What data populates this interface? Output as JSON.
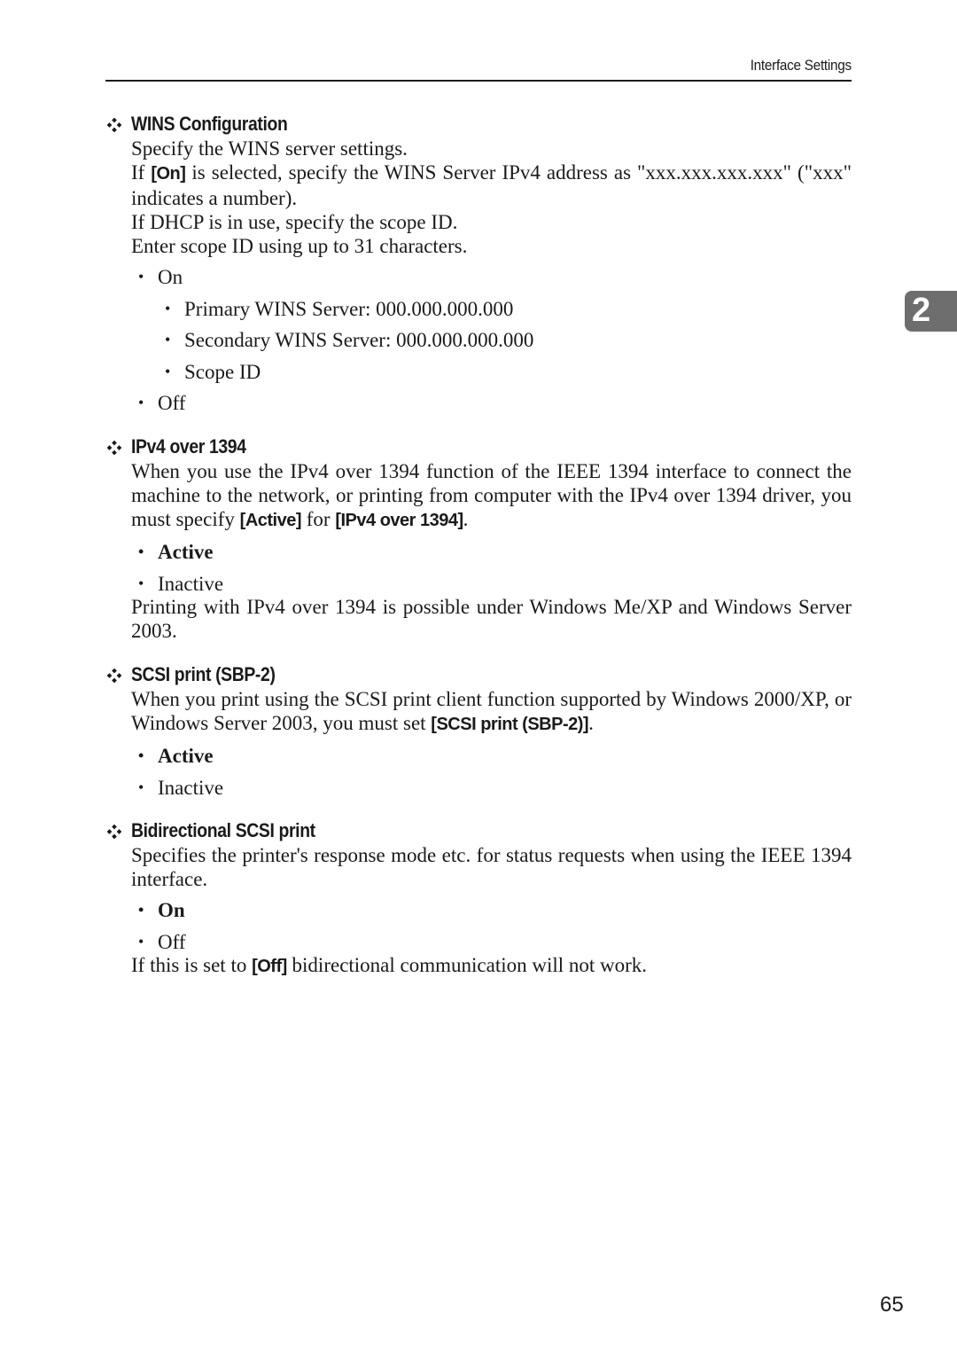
{
  "header": {
    "running_title": "Interface Settings"
  },
  "chapter_tab": {
    "number": "2"
  },
  "sections": {
    "wins": {
      "heading": "WINS Configuration",
      "p1": "Specify the WINS server settings.",
      "p2_pre": "If ",
      "p2_kw": "[On]",
      "p2_post": " is selected, specify the WINS Server IPv4 address as \"xxx.xxx.xxx.xxx\" (\"xxx\" indicates a number).",
      "p3": "If DHCP is in use, specify the scope ID.",
      "p4": "Enter scope ID using up to 31 characters.",
      "options": {
        "on": "On",
        "primary": "Primary WINS Server: 000.000.000.000",
        "secondary": "Secondary WINS Server: 000.000.000.000",
        "scope": "Scope ID",
        "off": "Off"
      }
    },
    "ipv4": {
      "heading": "IPv4 over 1394",
      "p1_pre": "When you use the IPv4 over 1394 function of the IEEE 1394 interface to connect the machine to the network, or printing from computer with the IPv4 over 1394 driver, you must specify ",
      "p1_kw1": "[Active]",
      "p1_mid": " for ",
      "p1_kw2": "[IPv4 over 1394]",
      "p1_post": ".",
      "options": {
        "active": "Active",
        "inactive": "Inactive"
      },
      "note": "Printing with IPv4 over 1394 is possible under Windows Me/XP and Windows Server 2003."
    },
    "scsi": {
      "heading": "SCSI print (SBP-2)",
      "p1_pre": "When you print using the SCSI print client function supported by Windows 2000/XP, or Windows Server 2003, you must set ",
      "p1_kw": "[SCSI print (SBP-2)]",
      "p1_post": ".",
      "options": {
        "active": "Active",
        "inactive": "Inactive"
      }
    },
    "bidi": {
      "heading": "Bidirectional SCSI print",
      "p1": "Specifies the printer's response mode etc. for status requests when using the IEEE 1394 interface.",
      "options": {
        "on": "On",
        "off": "Off"
      },
      "note_pre": "If this is set to ",
      "note_kw": "[Off]",
      "note_post": " bidirectional communication will not work."
    }
  },
  "bullet_glyph": "•",
  "page_number": "65"
}
